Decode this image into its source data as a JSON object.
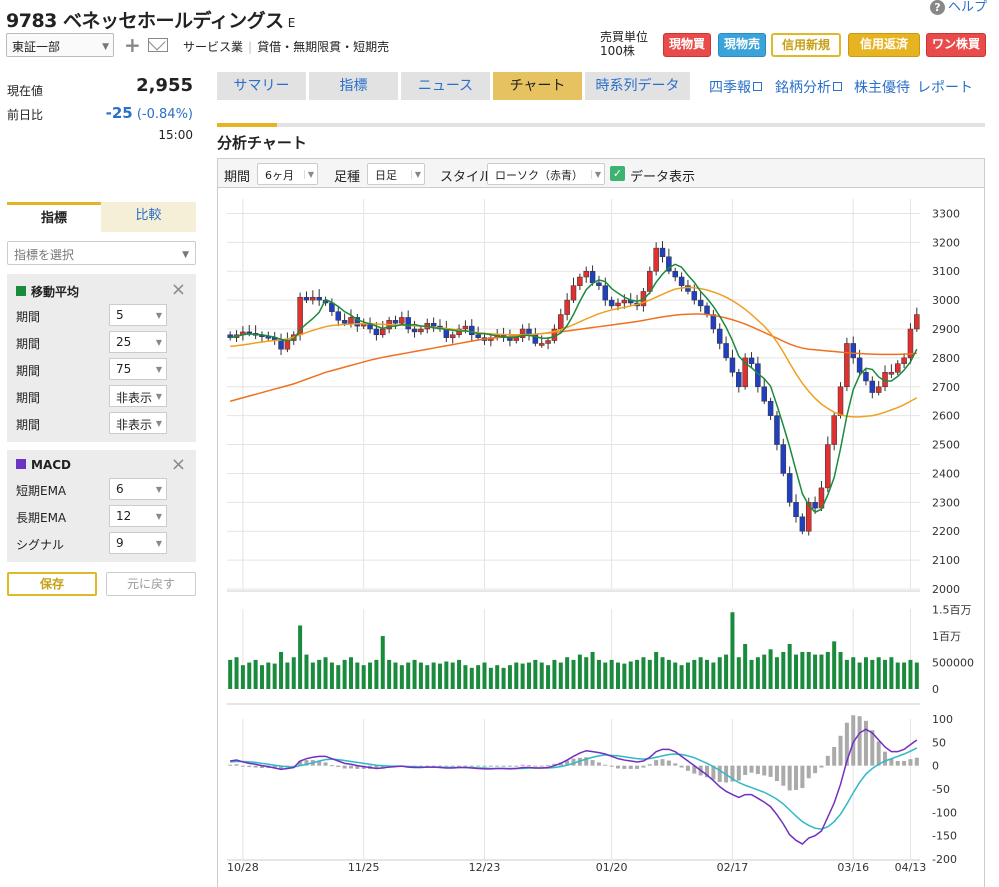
{
  "header": {
    "code": "9783",
    "name": "ベネッセホールディングス",
    "suffix": "E",
    "help": "ヘルプ",
    "market": "東証一部",
    "sector": "サービス業",
    "sector2": "貸借・無期限貫・短期売",
    "unit_label": "売買単位",
    "unit_value": "100株"
  },
  "trade_buttons": [
    "現物買",
    "現物売",
    "信用新規",
    "信用返済",
    "ワン株買"
  ],
  "quote": {
    "price_label": "現在値",
    "price": "2,955",
    "change_label": "前日比",
    "change": "-25",
    "change_pct": "(-0.84%)",
    "time": "15:00"
  },
  "side_tabs": [
    "指標",
    "比較"
  ],
  "indicator_select": "指標を選択",
  "ma_panel": {
    "title": "移動平均",
    "color": "#1a8a3c",
    "rows": [
      {
        "label": "期間",
        "value": "5"
      },
      {
        "label": "期間",
        "value": "25"
      },
      {
        "label": "期間",
        "value": "75"
      },
      {
        "label": "期間",
        "value": "非表示"
      },
      {
        "label": "期間",
        "value": "非表示"
      }
    ]
  },
  "macd_panel": {
    "title": "MACD",
    "color": "#6a35c4",
    "rows": [
      {
        "label": "短期EMA",
        "value": "6"
      },
      {
        "label": "長期EMA",
        "value": "12"
      },
      {
        "label": "シグナル",
        "value": "9"
      }
    ]
  },
  "save_label": "保存",
  "reset_label": "元に戻す",
  "main_tabs": [
    "サマリー",
    "指標",
    "ニュース",
    "チャート",
    "時系列データ"
  ],
  "top_links": [
    "四季報",
    "銘柄分析",
    "株主優待",
    "レポート"
  ],
  "section_title": "分析チャート",
  "controls": {
    "period_label": "期間",
    "period": "6ヶ月",
    "ashi_label": "足種",
    "ashi": "日足",
    "style_label": "スタイル",
    "style": "ローソク（赤青）",
    "data_label": "データ表示"
  },
  "chart_data": {
    "type": "candlestick",
    "price_axis": [
      "3300",
      "3200",
      "3100",
      "3000",
      "2900",
      "2800",
      "2700",
      "2600",
      "2500",
      "2400",
      "2300",
      "2200",
      "2100",
      "2000"
    ],
    "volume_axis": [
      "1.5百万",
      "1百万",
      "500000",
      "0"
    ],
    "macd_axis": [
      "100",
      "50",
      "0",
      "-50",
      "-100",
      "-150",
      "-200"
    ],
    "x_labels": [
      "10/28",
      "11/25",
      "12/23",
      "01/20",
      "02/17",
      "03/16",
      "04/13"
    ],
    "closes": [
      2870,
      2880,
      2890,
      2885,
      2880,
      2875,
      2870,
      2860,
      2830,
      2860,
      2880,
      3010,
      3000,
      3010,
      3000,
      2990,
      2960,
      2930,
      2920,
      2940,
      2910,
      2920,
      2900,
      2880,
      2900,
      2930,
      2920,
      2940,
      2900,
      2890,
      2900,
      2920,
      2910,
      2900,
      2870,
      2880,
      2900,
      2910,
      2880,
      2870,
      2860,
      2870,
      2880,
      2870,
      2860,
      2870,
      2900,
      2880,
      2850,
      2850,
      2860,
      2900,
      2950,
      3000,
      3050,
      3080,
      3100,
      3060,
      3050,
      3000,
      2980,
      2990,
      3000,
      2990,
      2980,
      3030,
      3100,
      3180,
      3150,
      3100,
      3080,
      3050,
      3030,
      3000,
      2980,
      2950,
      2900,
      2850,
      2800,
      2750,
      2700,
      2800,
      2780,
      2700,
      2650,
      2600,
      2500,
      2400,
      2300,
      2250,
      2200,
      2300,
      2280,
      2350,
      2500,
      2600,
      2700,
      2850,
      2800,
      2750,
      2720,
      2680,
      2700,
      2750,
      2750,
      2780,
      2800,
      2900,
      2950
    ],
    "ma5": [
      2870,
      2875,
      2880,
      2883,
      2881,
      2880,
      2876,
      2872,
      2864,
      2860,
      2864,
      2898,
      2918,
      2936,
      2958,
      3002,
      2992,
      2978,
      2960,
      2948,
      2932,
      2924,
      2918,
      2910,
      2902,
      2908,
      2910,
      2916,
      2912,
      2916,
      2910,
      2910,
      2904,
      2902,
      2898,
      2896,
      2892,
      2894,
      2890,
      2884,
      2884,
      2880,
      2876,
      2872,
      2870,
      2872,
      2878,
      2878,
      2874,
      2868,
      2868,
      2874,
      2886,
      2912,
      2950,
      2996,
      3036,
      3058,
      3070,
      3064,
      3040,
      3024,
      3010,
      3000,
      2996,
      3002,
      3026,
      3062,
      3090,
      3112,
      3124,
      3114,
      3086,
      3062,
      3030,
      3006,
      2978,
      2944,
      2906,
      2860,
      2806,
      2782,
      2766,
      2746,
      2728,
      2702,
      2636,
      2566,
      2492,
      2410,
      2330,
      2290,
      2266,
      2276,
      2326,
      2386,
      2486,
      2600,
      2690,
      2740,
      2764,
      2760,
      2734,
      2720,
      2720,
      2736,
      2758,
      2786,
      2830
    ],
    "ma25": [
      2840,
      2842,
      2845,
      2848,
      2852,
      2855,
      2858,
      2860,
      2862,
      2866,
      2872,
      2880,
      2888,
      2895,
      2902,
      2908,
      2912,
      2914,
      2916,
      2917,
      2918,
      2918,
      2918,
      2917,
      2916,
      2915,
      2914,
      2913,
      2912,
      2911,
      2910,
      2908,
      2906,
      2904,
      2902,
      2899,
      2896,
      2893,
      2890,
      2887,
      2885,
      2883,
      2882,
      2881,
      2880,
      2880,
      2880,
      2881,
      2882,
      2884,
      2887,
      2892,
      2898,
      2906,
      2915,
      2925,
      2935,
      2944,
      2953,
      2960,
      2966,
      2971,
      2975,
      2980,
      2985,
      2992,
      3000,
      3010,
      3020,
      3030,
      3038,
      3042,
      3044,
      3043,
      3040,
      3035,
      3028,
      3020,
      3010,
      2998,
      2984,
      2968,
      2950,
      2930,
      2910,
      2885,
      2855,
      2820,
      2782,
      2745,
      2712,
      2684,
      2660,
      2640,
      2625,
      2612,
      2603,
      2598,
      2596,
      2596,
      2598,
      2600,
      2605,
      2612,
      2620,
      2628,
      2638,
      2650,
      2662
    ],
    "ma75": [
      2650,
      2656,
      2662,
      2668,
      2674,
      2680,
      2686,
      2692,
      2698,
      2704,
      2710,
      2718,
      2726,
      2734,
      2742,
      2750,
      2756,
      2762,
      2768,
      2774,
      2780,
      2786,
      2792,
      2797,
      2802,
      2806,
      2810,
      2814,
      2818,
      2822,
      2826,
      2830,
      2834,
      2838,
      2842,
      2846,
      2850,
      2854,
      2858,
      2862,
      2865,
      2868,
      2870,
      2872,
      2874,
      2876,
      2878,
      2880,
      2882,
      2884,
      2886,
      2888,
      2890,
      2893,
      2896,
      2899,
      2902,
      2905,
      2908,
      2911,
      2914,
      2917,
      2920,
      2923,
      2926,
      2930,
      2934,
      2938,
      2942,
      2945,
      2948,
      2950,
      2951,
      2952,
      2952,
      2950,
      2947,
      2943,
      2938,
      2932,
      2925,
      2917,
      2908,
      2898,
      2888,
      2878,
      2868,
      2858,
      2848,
      2840,
      2834,
      2830,
      2828,
      2826,
      2824,
      2822,
      2820,
      2818,
      2816,
      2815,
      2814,
      2813,
      2812,
      2812,
      2812,
      2812,
      2813,
      2814,
      2816
    ],
    "volumes": [
      0.55,
      0.6,
      0.45,
      0.5,
      0.55,
      0.45,
      0.5,
      0.48,
      0.7,
      0.5,
      0.6,
      1.2,
      0.65,
      0.5,
      0.55,
      0.6,
      0.5,
      0.45,
      0.55,
      0.6,
      0.5,
      0.45,
      0.5,
      0.55,
      1.0,
      0.55,
      0.5,
      0.45,
      0.5,
      0.55,
      0.5,
      0.45,
      0.5,
      0.48,
      0.52,
      0.5,
      0.55,
      0.45,
      0.4,
      0.45,
      0.5,
      0.4,
      0.45,
      0.4,
      0.45,
      0.5,
      0.48,
      0.5,
      0.55,
      0.5,
      0.45,
      0.55,
      0.5,
      0.6,
      0.55,
      0.65,
      0.6,
      0.7,
      0.55,
      0.5,
      0.55,
      0.5,
      0.48,
      0.52,
      0.55,
      0.6,
      0.55,
      0.7,
      0.6,
      0.55,
      0.5,
      0.45,
      0.5,
      0.55,
      0.6,
      0.55,
      0.5,
      0.6,
      0.65,
      1.45,
      0.6,
      0.85,
      0.55,
      0.6,
      0.65,
      0.75,
      0.6,
      0.7,
      0.85,
      0.65,
      0.7,
      0.7,
      0.65,
      0.65,
      0.7,
      0.9,
      0.7,
      0.55,
      0.6,
      0.5,
      0.6,
      0.55,
      0.6,
      0.55,
      0.6,
      0.5,
      0.5,
      0.55,
      0.5
    ],
    "macd": [
      10,
      12,
      8,
      5,
      3,
      0,
      -2,
      -5,
      -8,
      -6,
      -4,
      10,
      15,
      18,
      20,
      20,
      15,
      10,
      5,
      3,
      0,
      -2,
      -4,
      -6,
      -5,
      -3,
      -2,
      -1,
      -3,
      -4,
      -4,
      -3,
      -3,
      -4,
      -5,
      -5,
      -4,
      -4,
      -5,
      -6,
      -7,
      -7,
      -6,
      -6,
      -7,
      -6,
      -4,
      -4,
      -5,
      -5,
      -4,
      0,
      5,
      12,
      20,
      27,
      32,
      30,
      28,
      25,
      20,
      15,
      12,
      10,
      8,
      10,
      18,
      30,
      35,
      35,
      30,
      20,
      10,
      0,
      -10,
      -20,
      -32,
      -45,
      -55,
      -62,
      -68,
      -62,
      -62,
      -70,
      -78,
      -88,
      -105,
      -125,
      -148,
      -160,
      -168,
      -155,
      -150,
      -140,
      -110,
      -80,
      -40,
      10,
      50,
      70,
      78,
      70,
      55,
      40,
      30,
      30,
      35,
      45,
      55
    ],
    "signal": [
      8,
      9,
      9,
      8,
      7,
      5,
      3,
      1,
      -1,
      -2,
      -3,
      0,
      3,
      6,
      10,
      13,
      14,
      13,
      11,
      9,
      7,
      5,
      3,
      1,
      0,
      -1,
      -1,
      -1,
      -2,
      -2,
      -3,
      -3,
      -3,
      -3,
      -4,
      -4,
      -4,
      -4,
      -4,
      -5,
      -5,
      -6,
      -6,
      -6,
      -6,
      -6,
      -6,
      -5,
      -5,
      -5,
      -5,
      -4,
      -2,
      1,
      5,
      10,
      14,
      18,
      21,
      23,
      22,
      21,
      19,
      17,
      15,
      14,
      15,
      18,
      21,
      24,
      25,
      24,
      21,
      17,
      11,
      5,
      -2,
      -10,
      -19,
      -28,
      -36,
      -42,
      -47,
      -52,
      -57,
      -64,
      -72,
      -82,
      -95,
      -108,
      -120,
      -128,
      -134,
      -136,
      -131,
      -120,
      -104,
      -82,
      -58,
      -36,
      -18,
      -6,
      3,
      10,
      15,
      20,
      25,
      31,
      38
    ]
  }
}
